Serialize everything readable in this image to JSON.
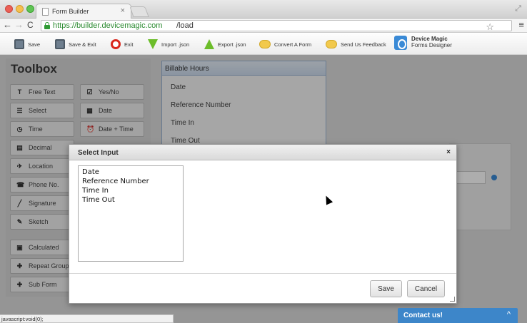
{
  "browser": {
    "tab_title": "Form Builder",
    "tab_close": "×",
    "url_secure": "https://builder.devicemagic.com",
    "url_path": "/load",
    "back": "←",
    "forward": "→",
    "reload": "C",
    "star": "☆",
    "menu": "≡",
    "resize": "⤢"
  },
  "toolbar": {
    "save": "Save",
    "save_exit": "Save & Exit",
    "exit": "Exit",
    "import_json": "Import .json",
    "export_json": "Export .json",
    "convert_form": "Convert A Form",
    "send_feedback": "Send Us Feedback",
    "logo_line1": "Device Magic",
    "logo_line2": "Forms Designer"
  },
  "toolbox": {
    "title": "Toolbox",
    "items": [
      {
        "label": "Free Text",
        "icon": "T"
      },
      {
        "label": "Yes/No",
        "icon": "☑"
      },
      {
        "label": "Select",
        "icon": "☰"
      },
      {
        "label": "Date",
        "icon": "▦"
      },
      {
        "label": "Time",
        "icon": "◷"
      },
      {
        "label": "Date + Time",
        "icon": "⏰"
      },
      {
        "label": "Decimal",
        "icon": "▤"
      },
      {
        "label": "Location",
        "icon": "✈"
      },
      {
        "label": "Phone No.",
        "icon": "☎"
      },
      {
        "label": "Signature",
        "icon": "╱"
      },
      {
        "label": "Sketch",
        "icon": "✎"
      },
      {
        "label": "Calculated",
        "icon": "▣"
      },
      {
        "label": "Repeat Group",
        "icon": "✚"
      },
      {
        "label": "Sub Form",
        "icon": "✚"
      }
    ]
  },
  "canvas": {
    "panel_title": "Billable Hours",
    "fields": [
      "Date",
      "Reference Number",
      "Time In",
      "Time Out"
    ]
  },
  "modal": {
    "title": "Select Input",
    "close": "×",
    "options": [
      "Date",
      "Reference Number",
      "Time In",
      "Time Out"
    ],
    "save_label": "Save",
    "cancel_label": "Cancel"
  },
  "status": {
    "text": "javascript:void(0);"
  },
  "contact": {
    "label": "Contact us!",
    "chevron": "^"
  },
  "colors": {
    "contact_blue": "#3d86c9",
    "panel_border": "#9ab4d4",
    "secure_green": "#2a8a2f"
  }
}
